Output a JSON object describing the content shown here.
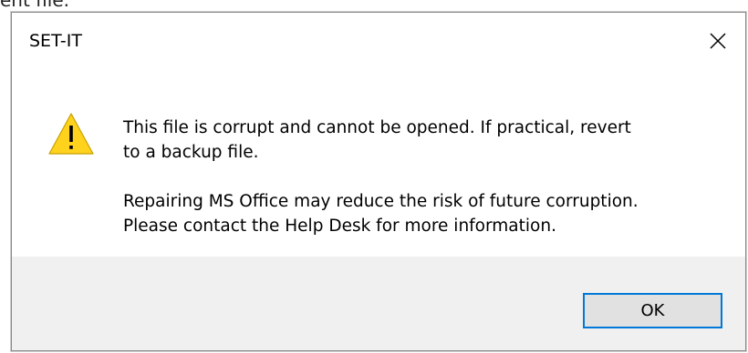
{
  "background": {
    "text": "ent file."
  },
  "dialog": {
    "title": "SET-IT",
    "close_icon": "close-icon",
    "warning_icon": "warning-icon",
    "message_line1": "This file is corrupt and cannot be opened. If practical, revert",
    "message_line2": "to a backup file.",
    "message_line3": "Repairing MS Office may reduce the risk of future corruption.",
    "message_line4": "Please contact the Help Desk for more information.",
    "ok_label": "OK"
  },
  "colors": {
    "accent_focus": "#0078d7",
    "warning_fill": "#ffd21e",
    "footer_bg": "#f0f0f0",
    "button_bg": "#e1e1e1"
  }
}
